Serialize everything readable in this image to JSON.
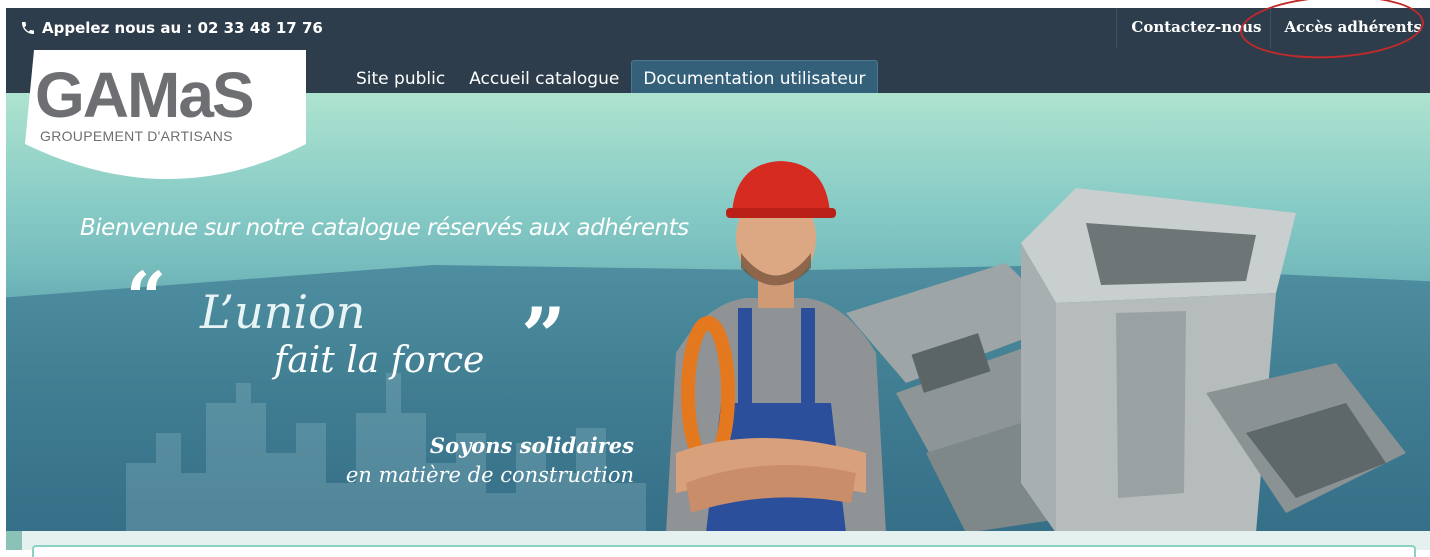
{
  "topbar": {
    "phone_label": "Appelez nous au : 02 33 48 17 76",
    "links": [
      {
        "label": "Contactez-nous"
      },
      {
        "label": "Accès adhérents"
      }
    ]
  },
  "logo": {
    "brand": "GAMaS",
    "tagline": "GROUPEMENT D'ARTISANS"
  },
  "nav": {
    "items": [
      {
        "label": "Site public"
      },
      {
        "label": "Accueil catalogue"
      },
      {
        "label": "Documentation utilisateur",
        "active": true
      }
    ]
  },
  "banner": {
    "welcome": "Bienvenue sur notre catalogue réservés aux adhérents",
    "quote_open": "“",
    "quote_close": "”",
    "slogan_line1": "L’union",
    "slogan_line2": "fait la force",
    "sub_line1": "Soyons solidaires",
    "sub_line2": "en matière de construction"
  },
  "colors": {
    "topbar_bg": "#2d3d4b",
    "accent_teal": "#3f7c91",
    "highlight_oval": "#c22a2a",
    "logo_gray": "#6e6f72"
  }
}
